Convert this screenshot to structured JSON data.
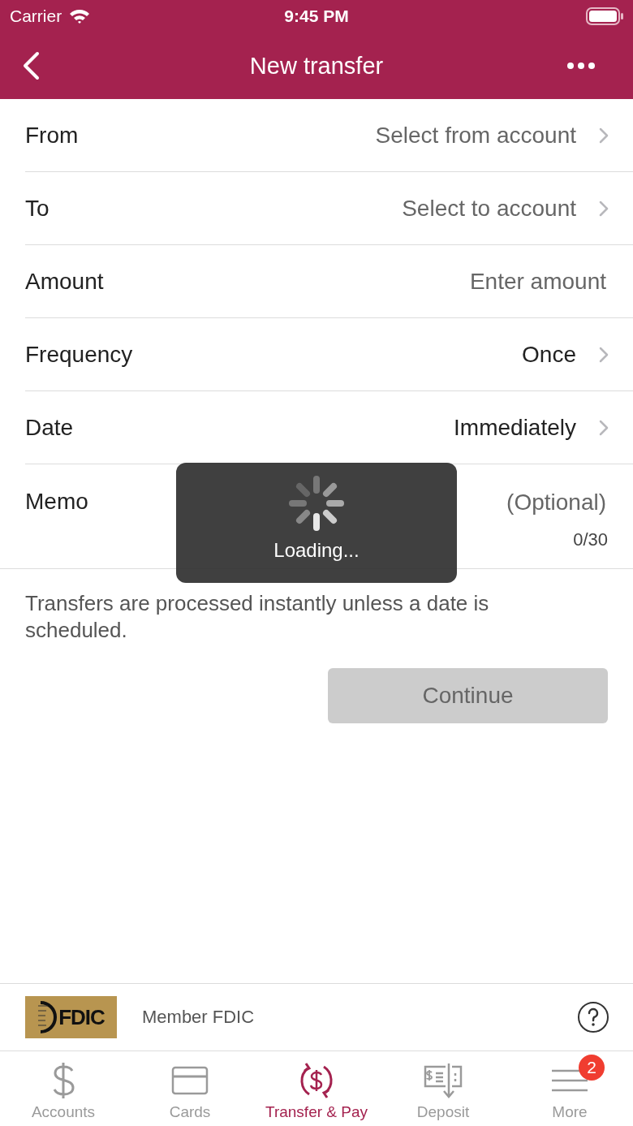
{
  "status_bar": {
    "carrier": "Carrier",
    "time": "9:45 PM"
  },
  "nav": {
    "title": "New transfer"
  },
  "rows": [
    {
      "kind": "select",
      "label": "From",
      "value": "Select from account",
      "placeholder": true
    },
    {
      "kind": "select",
      "label": "To",
      "value": "Select to account",
      "placeholder": true
    },
    {
      "kind": "input",
      "label": "Amount",
      "placeholder": "Enter amount"
    },
    {
      "kind": "select",
      "label": "Frequency",
      "value": "Once",
      "placeholder": false
    },
    {
      "kind": "select",
      "label": "Date",
      "value": "Immediately",
      "placeholder": false
    },
    {
      "kind": "memo",
      "label": "Memo",
      "placeholder": "(Optional)",
      "counter": "0/30"
    }
  ],
  "note": "Transfers are processed instantly unless a date is scheduled.",
  "continue_button": {
    "label": "Continue",
    "disabled": true
  },
  "loading": {
    "text": "Loading..."
  },
  "footer": {
    "logo_text": "FDIC",
    "member": "Member FDIC"
  },
  "tabs": [
    {
      "kind": "dollar",
      "label": "Accounts",
      "selected": false
    },
    {
      "kind": "card",
      "label": "Cards",
      "selected": false
    },
    {
      "kind": "transfer",
      "label": "Transfer & Pay",
      "selected": true
    },
    {
      "kind": "deposit",
      "label": "Deposit",
      "selected": false
    },
    {
      "kind": "menu",
      "label": "More",
      "selected": false,
      "badge": "2"
    }
  ]
}
